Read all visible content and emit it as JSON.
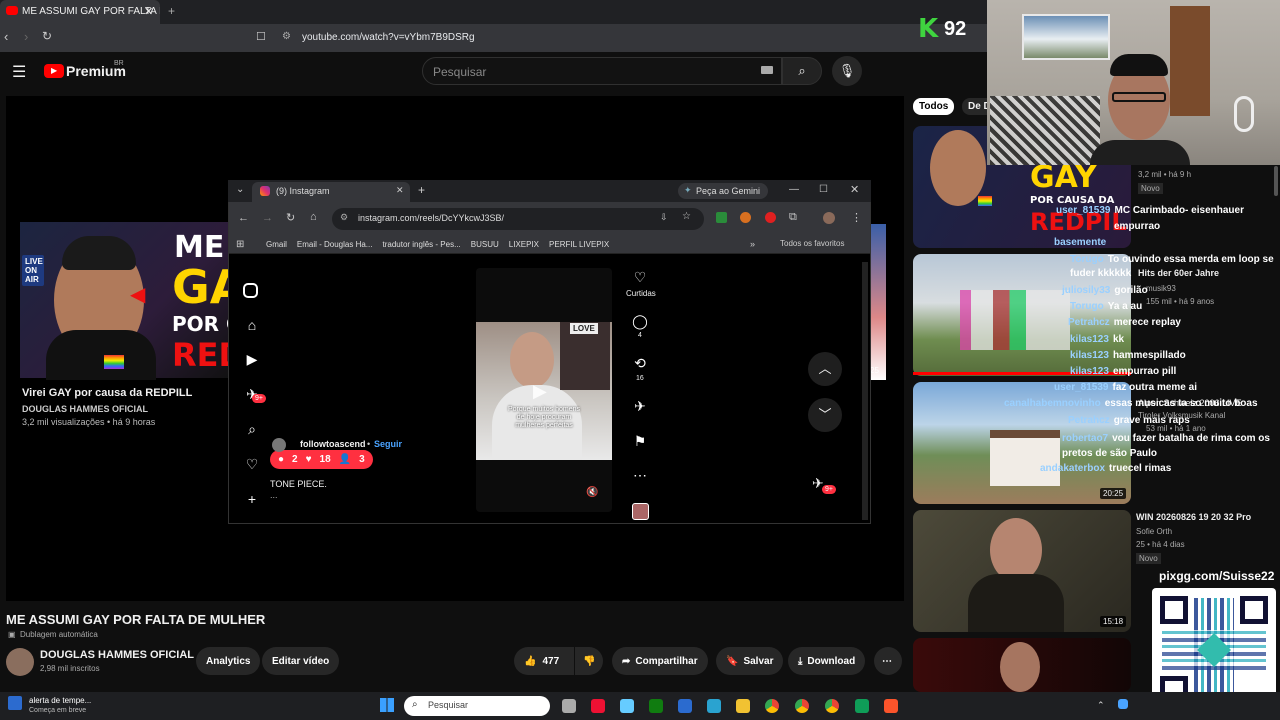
{
  "browser": {
    "tab_title": "ME ASSUMI GAY POR FALTA DE",
    "url": "youtube.com/watch?v=vYbm7B9DSRg"
  },
  "youtube": {
    "brand": "Premium",
    "brand_region": "BR",
    "search_placeholder": "Pesquisar",
    "video_title": "ME ASSUMI GAY POR FALTA DE MULHER",
    "dub_label": "Dublagem automática",
    "channel_name": "DOUGLAS HAMMES OFICIAL",
    "subscribers": "2,98 mil inscritos",
    "analytics_label": "Analytics",
    "edit_label": "Editar vídeo",
    "likes": "477",
    "share_label": "Compartilhar",
    "save_label": "Salvar",
    "download_label": "Download",
    "chip_all": "Todos",
    "chip_from": "De D"
  },
  "background_video": {
    "thumb_title": "Virei GAY por causa da REDPILL",
    "thumb_channel": "DOUGLAS HAMMES OFICIAL",
    "thumb_meta": "3,2 mil visualizações • há 9 horas",
    "overlay_text_1": "ME TO",
    "overlay_text_2": "GA",
    "overlay_text_3": "POR CA",
    "overlay_text_4": "RED",
    "live_badge": "LIVE ON AIR"
  },
  "instagram_window": {
    "tab_title": "(9) Instagram",
    "gemini_label": "Peça ao Gemini",
    "url": "instagram.com/reels/DcYYkcwJ3SB/",
    "bookmarks": [
      "Gmail",
      "Email - Douglas Ha...",
      "tradutor inglês - Pes...",
      "BUSUU",
      "LIXEPIX",
      "PERFIL LIVEPIX"
    ],
    "all_favorites": "Todos os favoritos",
    "likes_label": "Curtidas",
    "comments_count": "4",
    "reposts_count": "16",
    "username": "followtoascend",
    "follow_label": "Seguir",
    "caption": "TONE PIECE.",
    "notif_comments": "2",
    "notif_likes": "18",
    "notif_follows": "3",
    "dm_badge": "9+",
    "nav_badge": "9+",
    "video_caption": "Porque muitos homens de hoje procuram mulheres perfeitas",
    "love_sign": "LOVE",
    "more_label": "..."
  },
  "stream_overlay": {
    "k_logo": "K",
    "k_count": "92",
    "pix_url": "pixgg.com/Suisse22"
  },
  "recommendations": [
    {
      "title": "GAY POR CAUSA DA REDPILL",
      "meta1": "3,2 mil • há 9 h",
      "badge": "Novo"
    },
    {
      "title": "Hits der 60er Jahre",
      "meta1": "155 mil • há 9 anos",
      "channel": "musik93"
    },
    {
      "title": "Alpen Schweiz 2006 LIVE",
      "channel": "Tiroler Volksmusik Kanal",
      "meta1": "53 mil • há 1 ano",
      "duration": "20:25"
    },
    {
      "title": "WIN 20260826 19 20 32 Pro",
      "channel": "Sofie Orth",
      "meta1": "25 • há 4 dias",
      "badge": "Novo",
      "duration": "15:18"
    }
  ],
  "chat": [
    {
      "user": "user_81539",
      "msg": "MC Carimbado- eisenhauer"
    },
    {
      "user": "",
      "msg": "empurrao"
    },
    {
      "user": "basemente",
      "msg": ""
    },
    {
      "user": "Torugo",
      "msg": "To ouvindo essa merda em loop se fuder kkkkkk"
    },
    {
      "user": "juliosily33",
      "msg": "gorilão"
    },
    {
      "user": "Torugo",
      "msg": "Ya a au"
    },
    {
      "user": "Petrahcz",
      "msg": "merece replay"
    },
    {
      "user": "kilas123",
      "msg": "kk"
    },
    {
      "user": "kilas123",
      "msg": "hammespillado"
    },
    {
      "user": "kilas123",
      "msg": "empurrao pill"
    },
    {
      "user": "user_81539",
      "msg": "faz outra meme ai"
    },
    {
      "user": "canalhabemnovinho",
      "msg": "essas musicas ta so muito boas"
    },
    {
      "user": "Petrahcz",
      "msg": "grave mais raps"
    },
    {
      "user": "robertao7",
      "msg": "vou fazer batalha de rima com os pretos de são Paulo"
    },
    {
      "user": "andakaterbox",
      "msg": "truecel rimas"
    }
  ],
  "taskbar": {
    "weather_title": "alerta de tempe...",
    "weather_sub": "Começa em breve",
    "search_placeholder": "Pesquisar"
  }
}
